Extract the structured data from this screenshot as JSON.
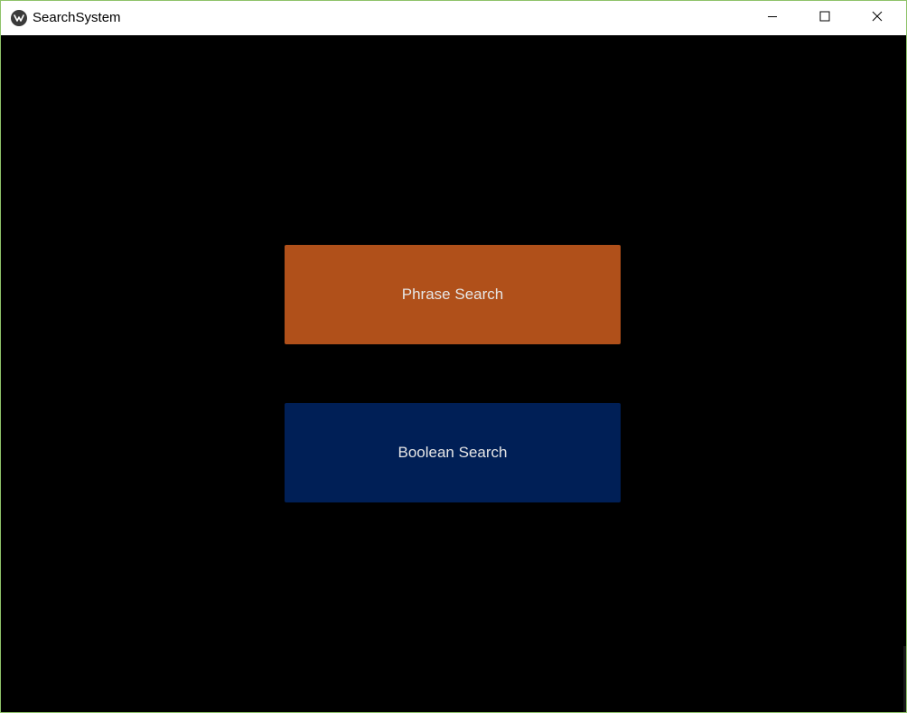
{
  "window": {
    "title": "SearchSystem",
    "app_icon": "kivy-logo-icon",
    "controls": {
      "minimize_icon": "minimize-icon",
      "maximize_icon": "maximize-icon",
      "close_icon": "close-icon"
    }
  },
  "main": {
    "buttons": [
      {
        "label": "Phrase Search",
        "color": "#b0501a"
      },
      {
        "label": "Boolean Search",
        "color": "#001f56"
      }
    ]
  },
  "colors": {
    "background": "#000000",
    "titlebar": "#ffffff",
    "button_text": "#e6e6e6",
    "window_border": "#8fc36a"
  }
}
